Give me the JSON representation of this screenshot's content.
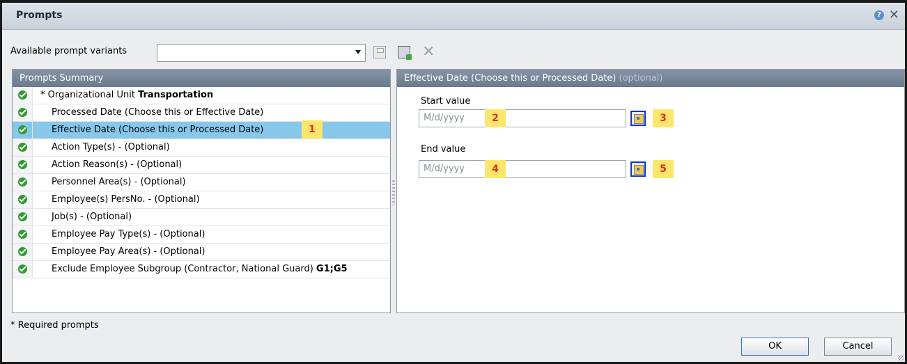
{
  "dialog": {
    "title": "Prompts",
    "help_icon": "?",
    "close_icon": "✕"
  },
  "variants": {
    "label": "Available prompt variants",
    "selected": ""
  },
  "summary": {
    "header": "Prompts Summary",
    "items": [
      {
        "prefix": "* ",
        "label": "Organizational Unit ",
        "value": "Transportation",
        "status": "check"
      },
      {
        "label": "Processed Date (Choose this or Effective Date)",
        "status": "check"
      },
      {
        "label": "Effective Date (Choose this or Processed Date)",
        "status": "check",
        "selected": true
      },
      {
        "label": "Action Type(s) - (Optional)",
        "status": "check"
      },
      {
        "label": "Action Reason(s) - (Optional)",
        "status": "check"
      },
      {
        "label": "Personnel Area(s) - (Optional)",
        "status": "check"
      },
      {
        "label": "Employee(s) PersNo. - (Optional)",
        "status": "check"
      },
      {
        "label": "Job(s) - (Optional)",
        "status": "check"
      },
      {
        "label": "Employee Pay Type(s) - (Optional)",
        "status": "check"
      },
      {
        "label": "Employee Pay Area(s) - (Optional)",
        "status": "check"
      },
      {
        "label": "Exclude Employee Subgroup (Contractor, National Guard) ",
        "value": "G1;G5",
        "status": "check"
      }
    ]
  },
  "detail": {
    "header": "Effective Date (Choose this or Processed Date)",
    "header_optional": " (optional)",
    "start": {
      "label": "Start value",
      "placeholder": "M/d/yyyy"
    },
    "end": {
      "label": "End value",
      "placeholder": "M/d/yyyy"
    }
  },
  "badges": [
    "1",
    "2",
    "3",
    "4",
    "5"
  ],
  "footer": {
    "required_note": "* Required prompts",
    "ok": "OK",
    "cancel": "Cancel"
  },
  "colors": {
    "selected_row": "#87c7ea",
    "header_bg": "#6a7a8e",
    "check_green": "#2f9c2f",
    "badge_bg": "#fde66b",
    "badge_text": "#d93025",
    "calendar_outline": "#1432d6"
  }
}
